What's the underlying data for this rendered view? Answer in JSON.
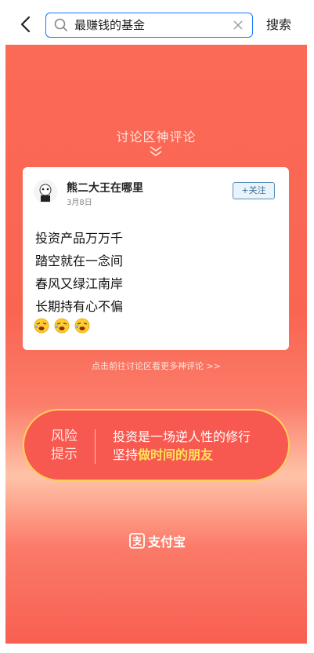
{
  "search": {
    "query": "最赚钱的基金",
    "button_label": "搜索"
  },
  "poster": {
    "section_title": "讨论区神评论",
    "comment": {
      "user_name": "熊二大王在哪里",
      "date": "3月8日",
      "follow_label": "+关注",
      "lines": [
        "投资产品万万千",
        "踏空就在一念间",
        "春风又绿江南岸",
        "长期持有心不偏"
      ],
      "emoji_count": 3
    },
    "more_link": "点击前往讨论区看更多神评论 >>",
    "risk": {
      "label_line1": "风险",
      "label_line2": "提示",
      "message_line1": "投资是一场逆人性的修行",
      "message_line2_prefix": "坚持",
      "message_line2_highlight": "做时间的朋友"
    },
    "brand_name": "支付宝"
  },
  "colors": {
    "accent": "#1677ff",
    "poster_red": "#fa6552",
    "highlight_yellow": "#ffe25a"
  }
}
